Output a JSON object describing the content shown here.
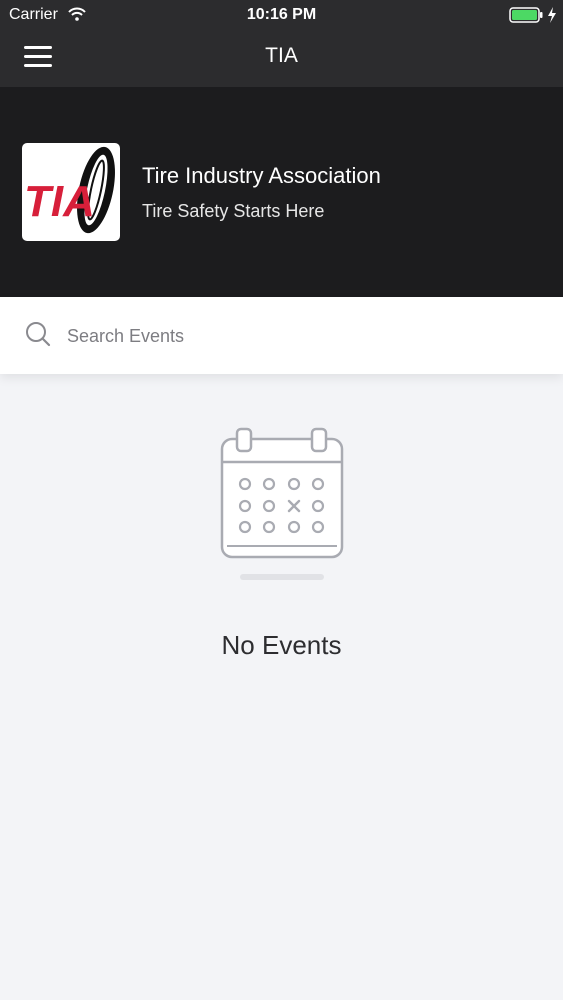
{
  "status_bar": {
    "carrier": "Carrier",
    "time": "10:16 PM",
    "battery_color": "#4cd964"
  },
  "nav": {
    "title": "TIA",
    "menu_icon": "hamburger-menu-icon"
  },
  "header": {
    "logo_text": "TIA",
    "org_name": "Tire Industry Association",
    "tagline": "Tire Safety Starts Here",
    "brand_color": "#d71f3a"
  },
  "search": {
    "placeholder": "Search Events",
    "icon": "search-icon"
  },
  "empty_state": {
    "icon": "calendar-icon",
    "message": "No Events"
  }
}
